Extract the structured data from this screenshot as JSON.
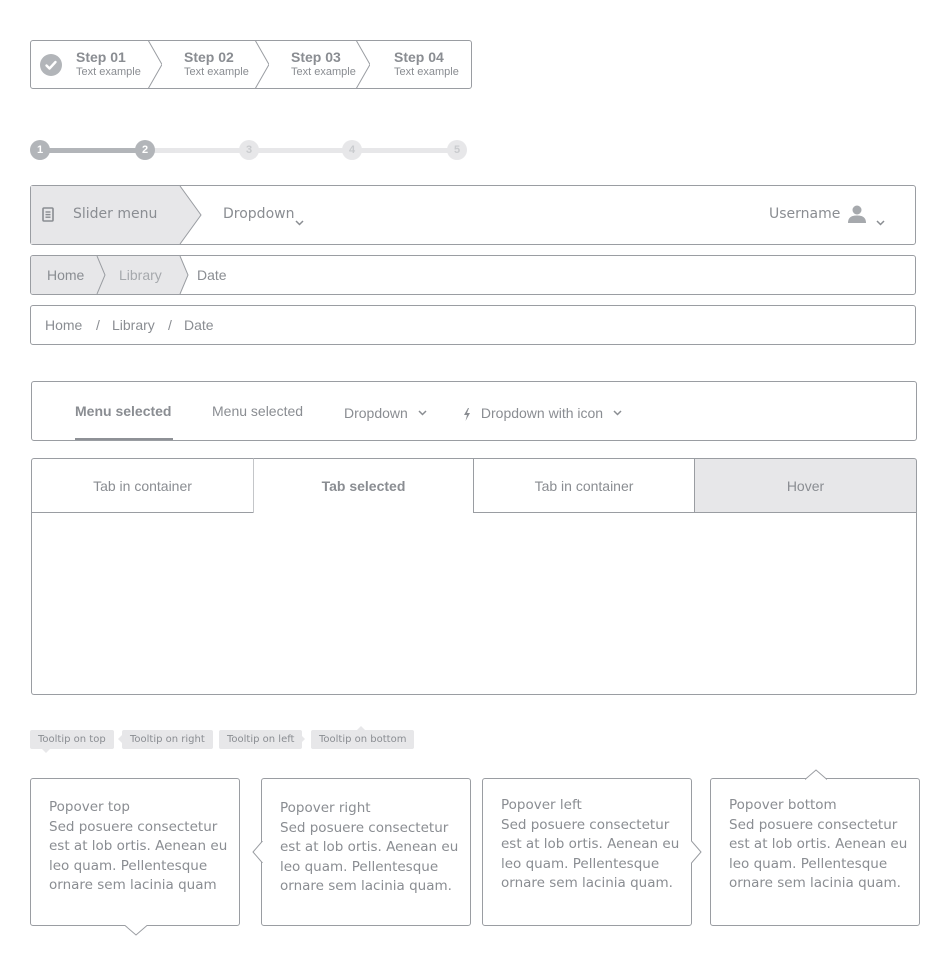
{
  "wizard": {
    "steps": [
      {
        "title": "Step 01",
        "subtitle": "Text example",
        "status": "completed"
      },
      {
        "title": "Step 02",
        "subtitle": "Text example",
        "status": "pending"
      },
      {
        "title": "Step 03",
        "subtitle": "Text example",
        "status": "pending"
      },
      {
        "title": "Step 04",
        "subtitle": "Text example",
        "status": "pending"
      }
    ]
  },
  "progress": {
    "steps": [
      "1",
      "2",
      "3",
      "4",
      "5"
    ],
    "current_step": 2,
    "total_steps": 5
  },
  "navbar": {
    "slider_menu_label": "Slider menu",
    "slider_menu_icon": "document-icon",
    "dropdown_label": "Dropdown",
    "username": "Username",
    "user_icon": "user-icon",
    "chevron": "⌄"
  },
  "breadcrumb_arrows": {
    "items": [
      "Home",
      "Library",
      "Date"
    ]
  },
  "breadcrumb_slash": {
    "items": [
      "Home",
      "Library",
      "Date"
    ],
    "separator": "/"
  },
  "menubar": {
    "items": [
      {
        "label": "Menu selected",
        "selected": true
      },
      {
        "label": "Menu selected",
        "selected": false
      },
      {
        "label": "Dropdown",
        "type": "dropdown"
      },
      {
        "label": "Dropdown with icon",
        "type": "dropdown",
        "icon": "lightning-icon"
      }
    ]
  },
  "tabs": {
    "items": [
      {
        "label": "Tab in container",
        "state": "default"
      },
      {
        "label": "Tab selected",
        "state": "selected"
      },
      {
        "label": "Tab in container",
        "state": "default"
      },
      {
        "label": "Hover",
        "state": "hover"
      }
    ]
  },
  "tooltips": [
    {
      "label": "Tooltip on top",
      "placement": "top"
    },
    {
      "label": "Tooltip on right",
      "placement": "right"
    },
    {
      "label": "Tooltip on left",
      "placement": "left"
    },
    {
      "label": "Tooltip on bottom",
      "placement": "bottom"
    }
  ],
  "popovers": [
    {
      "title": "Popover top",
      "body": "Sed posuere consectetur est at lob ortis. Aenean eu leo quam. Pellentesque ornare sem lacinia quam",
      "placement": "top"
    },
    {
      "title": "Popover right",
      "body": "Sed posuere consectetur est at lob ortis. Aenean eu leo quam. Pellentesque ornare sem lacinia quam.",
      "placement": "right"
    },
    {
      "title": "Popover left",
      "body": "Sed posuere consectetur est at lob ortis. Aenean eu leo quam. Pellentesque ornare sem lacinia quam.",
      "placement": "left"
    },
    {
      "title": "Popover bottom",
      "body": "Sed posuere consectetur est at lob ortis. Aenean eu leo quam. Pellentesque ornare sem lacinia quam.",
      "placement": "bottom"
    }
  ],
  "colors": {
    "border": "#9a9da2",
    "text": "#8a8d92",
    "fill_light": "#e7e7e9",
    "active": "#b2b5b9",
    "inactive": "#e7e7e9"
  }
}
